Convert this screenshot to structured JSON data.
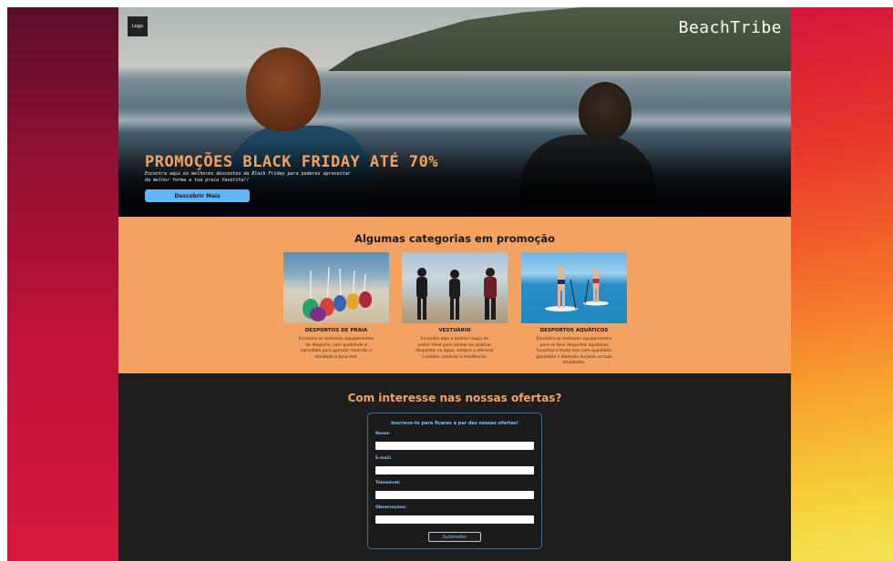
{
  "header": {
    "logo_text": "Logo",
    "brand": "BeachTribe"
  },
  "hero": {
    "title": "PROMOÇÕES BLACK FRIDAY ATÉ 70%",
    "subtitle": "Encontra aqui os melhores descontos da Black Friday para poderes aproveitar da melhor forma a tua praia favorita!!",
    "cta_label": "Descobrir Mais"
  },
  "categories": {
    "title": "Algumas categorias em promoção",
    "items": [
      {
        "name": "DESPORTOS DE PRAIA",
        "description": "Encontra os melhores equipamentos de desporto, com qualidade e variedade para garantir diversão e atividade à tona mar."
      },
      {
        "name": "VESTUÁRIO",
        "description": "Encontra aqui a melhor roupa de praia! Ideal para relaxar ou praticar desportos na água, sempre a oferecer o melhor conforto e tendências."
      },
      {
        "name": "DESPORTOS AQUÁTICOS",
        "description": "Encontra os melhores equipamentos para os teus desportos aquáticos favoritos e tenta mar com qualidade garantida e diversão durante as tuas atividades."
      }
    ]
  },
  "offers": {
    "title": "Com interesse nas nossas ofertas?",
    "form_heading": "Inscreve-te para ficares a par das nossas ofertas!",
    "fields": {
      "nome_label": "Nome:",
      "email_label": "E-mail:",
      "telemovel_label": "Telemóvel:",
      "observacoes_label": "Observações:"
    },
    "submit_label": "Submeter"
  },
  "colors": {
    "accent_orange": "#f4a261",
    "accent_blue": "#64b5f6",
    "dark": "#1e1e1e"
  }
}
